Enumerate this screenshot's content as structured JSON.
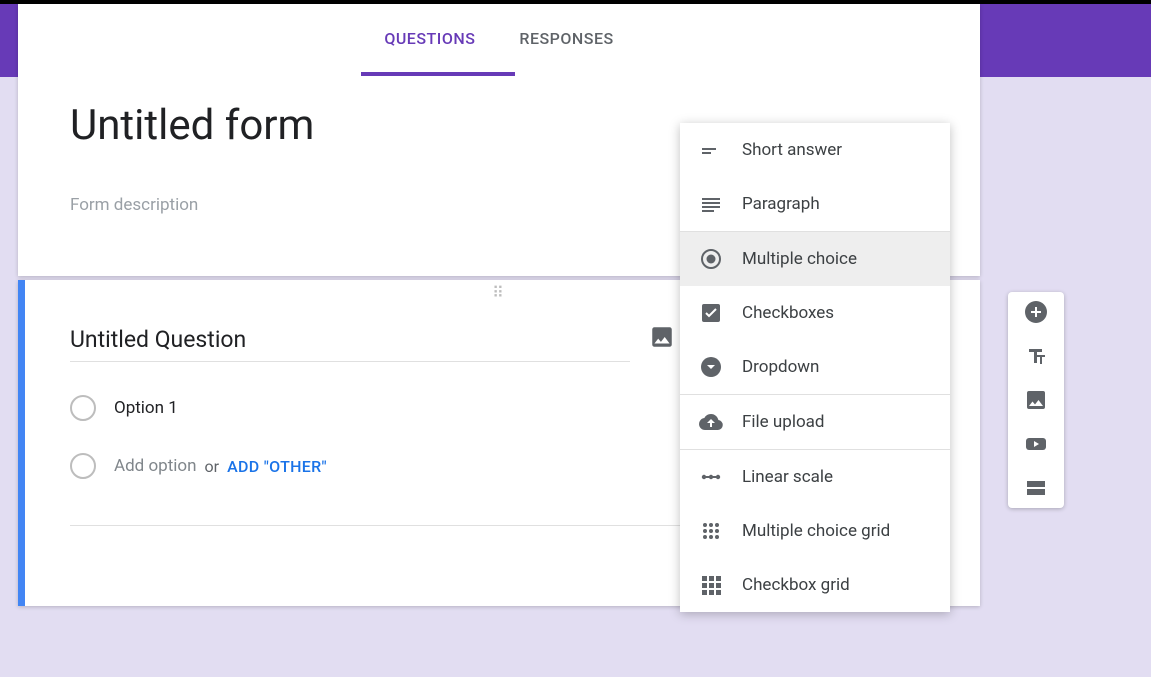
{
  "tabs": {
    "questions": "QUESTIONS",
    "responses": "RESPONSES"
  },
  "form": {
    "title": "Untitled form",
    "description_placeholder": "Form description"
  },
  "question": {
    "title": "Untitled Question",
    "option1": "Option 1",
    "add_option_placeholder": "Add option",
    "or_text": "or",
    "add_other": "ADD \"OTHER\""
  },
  "type_menu": {
    "short_answer": "Short answer",
    "paragraph": "Paragraph",
    "multiple_choice": "Multiple choice",
    "checkboxes": "Checkboxes",
    "dropdown": "Dropdown",
    "file_upload": "File upload",
    "linear_scale": "Linear scale",
    "multiple_choice_grid": "Multiple choice grid",
    "checkbox_grid": "Checkbox grid"
  }
}
